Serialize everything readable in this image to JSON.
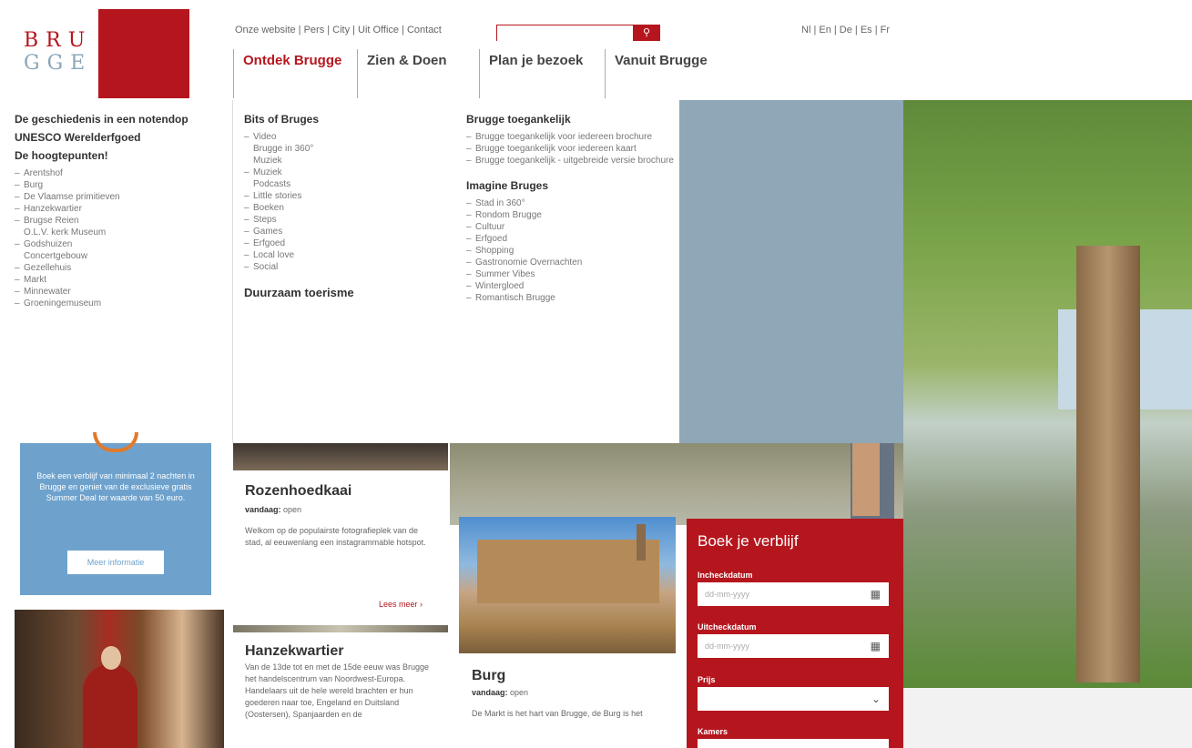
{
  "logo": {
    "line1": "BRU",
    "line2": "GGE"
  },
  "top_links": [
    "Onze website",
    "Pers",
    "City",
    "Uit Office",
    "Contact"
  ],
  "search": {
    "placeholder": "",
    "button_icon": "search-icon"
  },
  "languages": "Nl | En | De | Es | Fr",
  "main_nav": [
    "Ontdek Brugge",
    "Zien & Doen",
    "Plan je bezoek",
    "Vanuit Brugge"
  ],
  "mega": {
    "col1": {
      "headings": [
        "De geschiedenis in een notendop",
        "UNESCO Werelderfgoed",
        "De hoogtepunten!"
      ],
      "items": [
        "Arentshof",
        "Burg",
        "De Vlaamse primitieven",
        "Hanzekwartier",
        "Brugse Reien",
        "O.L.V. kerk Museum",
        "Godshuizen",
        "Concertgebouw",
        "Gezellehuis",
        "Markt",
        "Minnewater",
        "Groeningemuseum"
      ]
    },
    "col2": {
      "heading": "Bits of Bruges",
      "items": [
        "Video",
        "Brugge in 360°",
        "Muziek",
        "Muziek",
        "Podcasts",
        "Little stories",
        "Boeken",
        "Steps",
        "Games",
        "Erfgoed",
        "Local love",
        "Social"
      ],
      "heading2": "Duurzaam toerisme"
    },
    "col3": {
      "heading": "Brugge toegankelijk",
      "items": [
        "Brugge toegankelijk voor iedereen brochure",
        "Brugge toegankelijk voor iedereen kaart",
        "Brugge toegankelijk - uitgebreide versie brochure"
      ],
      "heading2": "Imagine Bruges",
      "items2": [
        "Stad in 360°",
        "Rondom Brugge",
        "Cultuur",
        "Erfgoed",
        "Shopping",
        "Gastronomie Overnachten",
        "Summer Vibes",
        "Wintergloed",
        "Romantisch Brugge"
      ]
    }
  },
  "promo": {
    "text": "Boek een verblijf van minimaal 2 nachten in Brugge en geniet van de exclusieve gratis Summer Deal ter waarde van 50 euro.",
    "button": "Meer informatie"
  },
  "cards": {
    "rozenhoedkaai": {
      "title": "Rozenhoedkaai",
      "hours_label": "vandaag:",
      "hours": "open",
      "desc": "Welkom op de populairste fotografieplek van de stad, al eeuwenlang een instagrammable hotspot.",
      "more": "Lees meer ›"
    },
    "hanzekwartier": {
      "title": "Hanzekwartier",
      "desc": "Van de 13de tot en met de 15de eeuw was Brugge het handelscentrum van Noordwest-Europa. Handelaars uit de hele wereld brachten er hun goederen naar toe, Engeland en Duitsland (Oostersen), Spanjaarden en de"
    },
    "burg": {
      "title": "Burg",
      "hours_label": "vandaag:",
      "hours": "open",
      "desc": "De Markt is het hart van Brugge, de Burg is het"
    }
  },
  "booking": {
    "title": "Boek je verblijf",
    "checkin_label": "Incheckdatum",
    "checkin_placeholder": "dd-mm-yyyy",
    "checkout_label": "Uitcheckdatum",
    "checkout_placeholder": "dd-mm-yyyy",
    "price_label": "Prijs",
    "rooms_label": "Kamers"
  }
}
